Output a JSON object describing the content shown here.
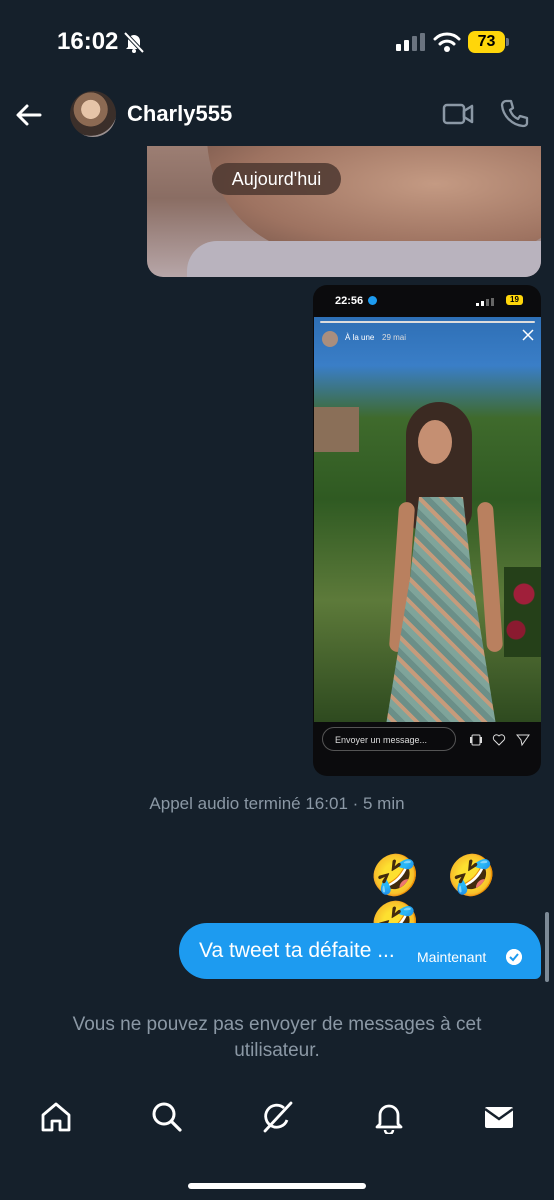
{
  "status_bar": {
    "time": "16:02",
    "battery": "73"
  },
  "header": {
    "username": "Charly555",
    "back_icon": "arrow-left-icon",
    "video_icon": "video-camera-icon",
    "call_icon": "phone-icon"
  },
  "conversation": {
    "date_separator": "Aujourd'hui",
    "story_card": {
      "status_time": "22:56",
      "battery": "19",
      "label": "À la une",
      "date": "29 mai",
      "input_placeholder": "Envoyer un message..."
    },
    "system_message": "Appel audio terminé 16:01 · 5 min",
    "emoji_message": "🤣 🤣 🤣",
    "sent_message": {
      "text": "Va tweet ta défaite ...",
      "timestamp": "Maintenant"
    },
    "notice": "Vous ne pouvez pas envoyer de messages à cet utilisateur."
  },
  "tab_bar": {
    "items": [
      {
        "name": "home",
        "icon": "home-icon"
      },
      {
        "name": "search",
        "icon": "search-icon"
      },
      {
        "name": "grok",
        "icon": "grok-icon"
      },
      {
        "name": "notifications",
        "icon": "bell-icon"
      },
      {
        "name": "messages",
        "icon": "envelope-icon"
      }
    ]
  },
  "colors": {
    "background": "#15202b",
    "accent": "#1d9bf0",
    "secondary_text": "#8b98a5"
  }
}
